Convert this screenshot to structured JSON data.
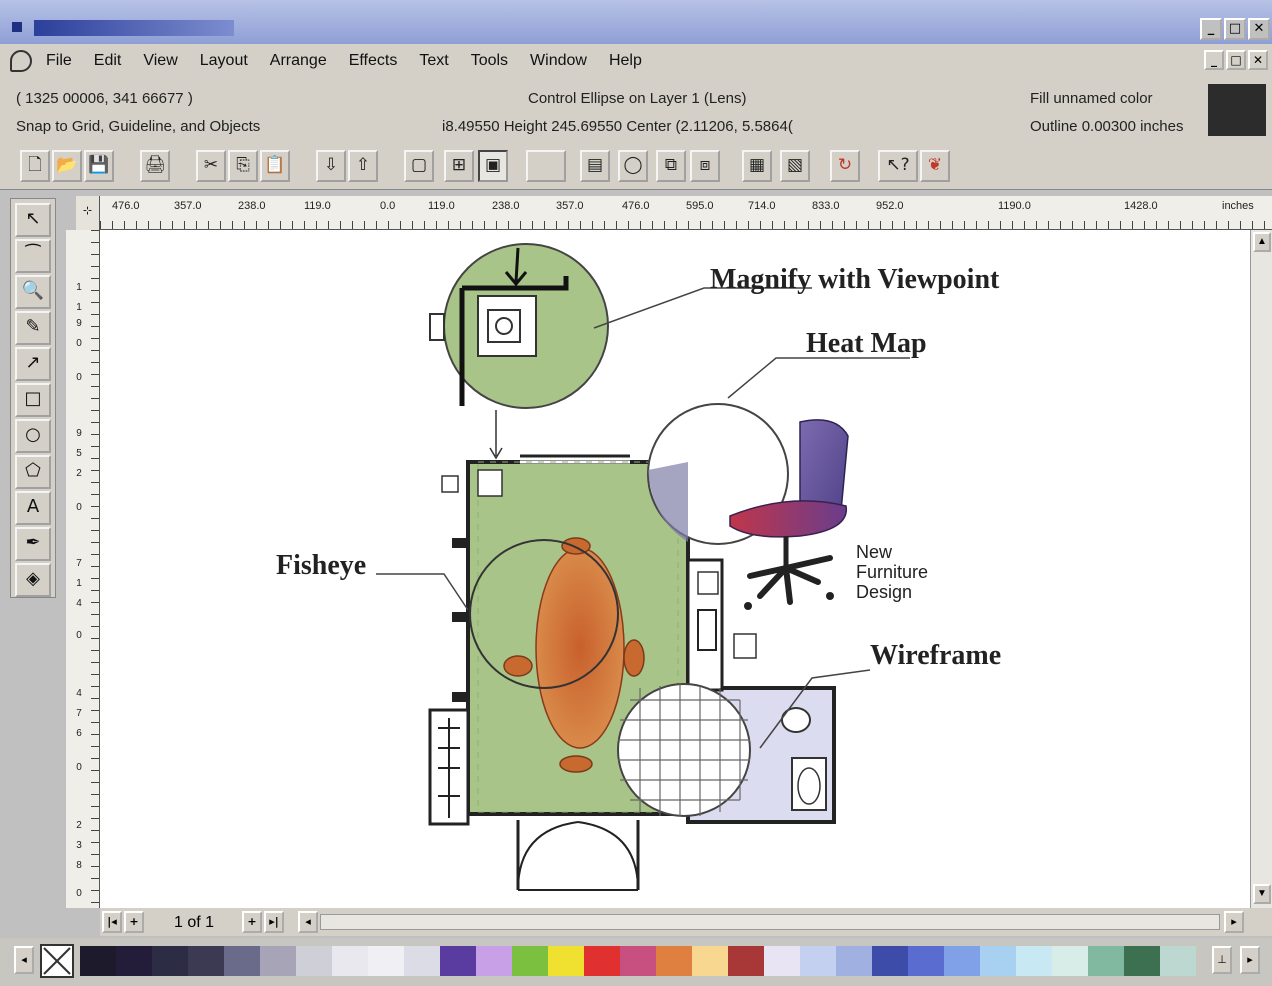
{
  "window": {
    "title": "",
    "controls": [
      "_",
      "□",
      "✕"
    ],
    "doc_controls": [
      "_",
      "□",
      "✕"
    ]
  },
  "menu": [
    {
      "key": "F",
      "rest": "ile"
    },
    {
      "key": "",
      "pre": "E",
      "u": "d",
      "rest": "it"
    },
    {
      "key": "V",
      "rest": "iew"
    },
    {
      "key": "L",
      "rest": "ayout"
    },
    {
      "key": "A",
      "rest": "rrange"
    },
    {
      "pre": "Effe",
      "u": "c",
      "rest": "ts"
    },
    {
      "pre": "Te",
      "u": "x",
      "rest": "t"
    },
    {
      "key": "T",
      "rest": "ools"
    },
    {
      "key": "W",
      "rest": "indow"
    },
    {
      "key": "H",
      "rest": "elp"
    }
  ],
  "menu_labels": [
    "File",
    "Edit",
    "View",
    "Layout",
    "Arrange",
    "Effects",
    "Text",
    "Tools",
    "Window",
    "Help"
  ],
  "property_bar": {
    "coords": "( 1325 00006, 341 66677 )",
    "snap": "Snap to Grid, Guideline, and Objects",
    "object": "Control Ellipse on Layer 1  (Lens)",
    "size": "i8.49550  Height  245.69550  Center  (2.11206, 5.5864(",
    "fill": "Fill  unnamed color",
    "outline": "Outline  0.00300 inches",
    "fill_color": "#2c2c2c"
  },
  "toolbar": {
    "buttons": [
      {
        "name": "new-icon",
        "glyph": "🗋"
      },
      {
        "name": "open-icon",
        "glyph": "📂"
      },
      {
        "name": "save-icon",
        "glyph": "💾"
      },
      {
        "name": "print-icon",
        "glyph": "🖨"
      },
      {
        "name": "cut-icon",
        "glyph": "✂"
      },
      {
        "name": "copy-icon",
        "glyph": "⎘"
      },
      {
        "name": "paste-icon",
        "glyph": "📋"
      },
      {
        "name": "import-icon",
        "glyph": "⇩"
      },
      {
        "name": "export-icon",
        "glyph": "⇧"
      },
      {
        "name": "full-screen-preview-icon",
        "glyph": "▢"
      },
      {
        "name": "wireframe-view-icon",
        "glyph": "⊞"
      },
      {
        "name": "enhanced-view-icon",
        "glyph": "▣"
      },
      {
        "name": "blank-button",
        "glyph": ""
      },
      {
        "name": "object-properties-icon",
        "glyph": "▤"
      },
      {
        "name": "shape-icon",
        "glyph": "◯"
      },
      {
        "name": "group-icon",
        "glyph": "⧉"
      },
      {
        "name": "ungroup-icon",
        "glyph": "⧈"
      },
      {
        "name": "layers-icon",
        "glyph": "▦"
      },
      {
        "name": "symbols-icon",
        "glyph": "▧"
      },
      {
        "name": "script-icon",
        "glyph": "↻"
      },
      {
        "name": "whats-this-icon",
        "glyph": "↖?"
      },
      {
        "name": "corel-tutor-icon",
        "glyph": "❦"
      }
    ]
  },
  "toolbox": [
    {
      "name": "pick-tool-icon",
      "glyph": "↖"
    },
    {
      "name": "shape-tool-icon",
      "glyph": "⁀"
    },
    {
      "name": "zoom-tool-icon",
      "glyph": "🔍"
    },
    {
      "name": "freehand-tool-icon",
      "glyph": "✎"
    },
    {
      "name": "dimension-tool-icon",
      "glyph": "↗"
    },
    {
      "name": "rectangle-tool-icon",
      "glyph": "□"
    },
    {
      "name": "ellipse-tool-icon",
      "glyph": "○"
    },
    {
      "name": "polygon-tool-icon",
      "glyph": "⬠"
    },
    {
      "name": "text-tool-icon",
      "glyph": "A"
    },
    {
      "name": "outline-tool-icon",
      "glyph": "✒"
    },
    {
      "name": "fill-tool-icon",
      "glyph": "◈"
    }
  ],
  "ruler": {
    "h_labels": [
      "476.0",
      "357.0",
      "238.0",
      "119.0",
      "0.0",
      "119.0",
      "238.0",
      "357.0",
      "476.0",
      "595.0",
      "714.0",
      "833.0",
      "952.0",
      "1190.0",
      "1428.0",
      "inches"
    ],
    "v_labels": [
      "1",
      "1",
      "9",
      "0",
      "0",
      "9",
      "5",
      "2",
      "0",
      "7",
      "1",
      "4",
      "0",
      "4",
      "7",
      "6",
      "0",
      "2",
      "3",
      "8",
      "0"
    ]
  },
  "canvas": {
    "callouts": {
      "magnify": "Magnify with Viewpoint",
      "heatmap": "Heat Map",
      "fisheye": "Fisheye",
      "wireframe": "Wireframe"
    },
    "note": [
      "New",
      "Furniture",
      "Design"
    ]
  },
  "page_nav": {
    "label": "1 of 1",
    "first": "|◂",
    "add_before": "+",
    "add_after": "+",
    "last": "▸|",
    "hscroll_left": "◂",
    "hscroll_right": "▸"
  },
  "palette": {
    "colors": [
      "#1d1a2c",
      "#241d3a",
      "#2c2c44",
      "#3c3a52",
      "#6a6a8a",
      "#a8a4b8",
      "#cfcfd8",
      "#e8e8ee",
      "#f0f0f4",
      "#dcdce6",
      "#5a3ca0",
      "#c8a0e8",
      "#7cc040",
      "#f0e030",
      "#e03030",
      "#c85080",
      "#e08040",
      "#f8d890",
      "#a83838",
      "#e8e4f4",
      "#c4d0f0",
      "#a0b0e0",
      "#3c4ca8",
      "#5a6cd0",
      "#80a0e8",
      "#a8d0f0",
      "#c8e8f4",
      "#d8ece8",
      "#80b8a0",
      "#3c7050",
      "#bdd8d0"
    ]
  }
}
